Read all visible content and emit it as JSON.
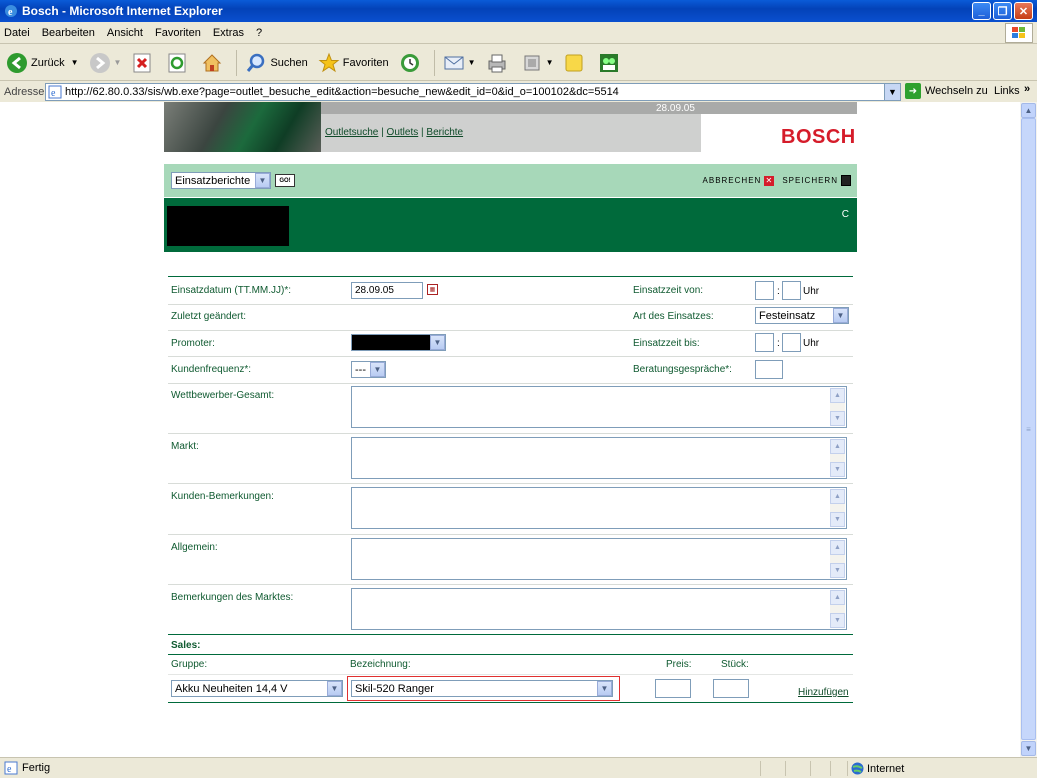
{
  "window": {
    "title": "Bosch - Microsoft Internet Explorer",
    "buttons": [
      "_",
      "❐",
      "✕"
    ]
  },
  "menu": [
    "Datei",
    "Bearbeiten",
    "Ansicht",
    "Favoriten",
    "Extras",
    "?"
  ],
  "toolbar": {
    "back": "Zurück",
    "search": "Suchen",
    "favorites": "Favoriten"
  },
  "address": {
    "label": "Adresse",
    "url": "http://62.80.0.33/sis/wb.exe?page=outlet_besuche_edit&action=besuche_new&edit_id=0&id_o=100102&dc=5514",
    "go": "Wechseln zu",
    "links": "Links"
  },
  "header": {
    "date": "28.09.05",
    "nav": [
      "Outletsuche",
      "Outlets",
      "Berichte"
    ],
    "nav_sep": "|",
    "brand": "BOSCH"
  },
  "selbar": {
    "select_value": "Einsatzberichte",
    "go": "GO!",
    "cancel": "ABBRECHEN",
    "save": "SPEICHERN"
  },
  "darkbar": {
    "letter": "C"
  },
  "form": {
    "einsatzdatum_label": "Einsatzdatum (TT.MM.JJ)*:",
    "einsatzdatum_value": "28.09.05",
    "einsatzzeit_von_label": "Einsatzzeit von:",
    "uhr": "Uhr",
    "colon": ":",
    "zuletzt_label": "Zuletzt geändert:",
    "art_label": "Art des Einsatzes:",
    "art_value": "Festeinsatz",
    "promoter_label": "Promoter:",
    "einsatzzeit_bis_label": "Einsatzzeit bis:",
    "kundenfrequenz_label": "Kundenfrequenz*:",
    "kundenfrequenz_value": "---",
    "beratung_label": "Beratungsgespräche*:",
    "wettbewerber_label": "Wettbewerber-Gesamt:",
    "markt_label": "Markt:",
    "kunden_label": "Kunden-Bemerkungen:",
    "allgemein_label": "Allgemein:",
    "bemerkungen_label": "Bemerkungen des Marktes:"
  },
  "sales": {
    "title": "Sales:",
    "gruppe_label": "Gruppe:",
    "bezeichnung_label": "Bezeichnung:",
    "preis_label": "Preis:",
    "stueck_label": "Stück:",
    "gruppe_value": "Akku Neuheiten 14,4 V",
    "bezeichnung_value": "Skil-520 Ranger",
    "add": "Hinzufügen"
  },
  "status": {
    "left": "Fertig",
    "zone": "Internet"
  }
}
